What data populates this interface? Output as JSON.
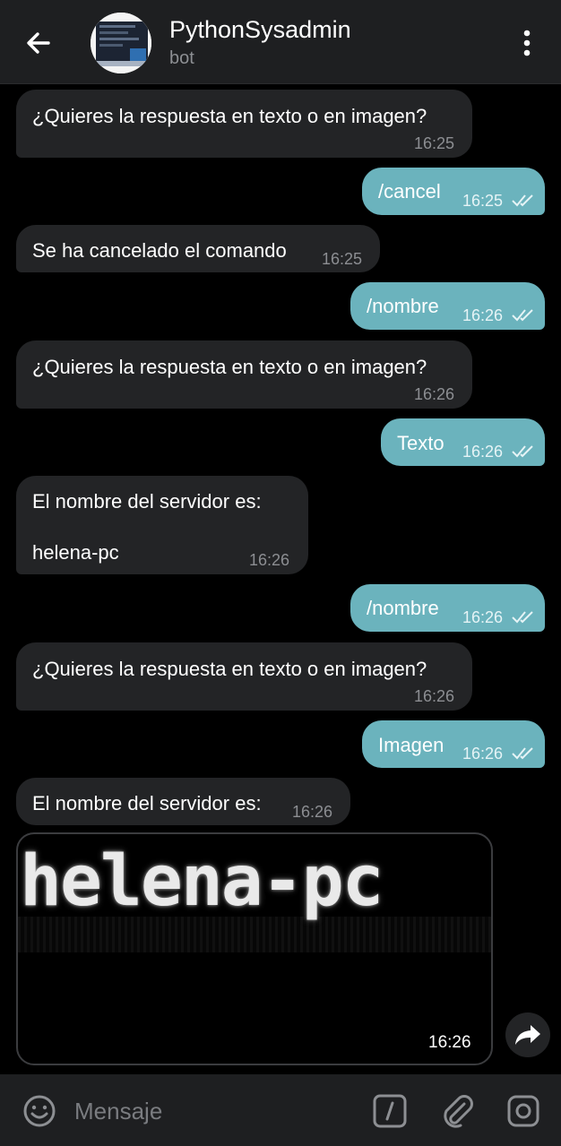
{
  "header": {
    "title": "PythonSysadmin",
    "subtitle": "bot",
    "icons": [
      "back-arrow-icon",
      "avatar",
      "more-vert-icon"
    ]
  },
  "messages": [
    {
      "dir": "in",
      "text": "¿Quieres la respuesta en texto o en imagen?",
      "time": "16:25"
    },
    {
      "dir": "out",
      "text": "/cancel",
      "time": "16:25",
      "status": "read"
    },
    {
      "dir": "in",
      "text": "Se ha cancelado el comando",
      "time": "16:25"
    },
    {
      "dir": "out",
      "text": "/nombre",
      "time": "16:26",
      "status": "read"
    },
    {
      "dir": "in",
      "text": "¿Quieres la respuesta en texto o en imagen?",
      "time": "16:26"
    },
    {
      "dir": "out",
      "text": "Texto",
      "time": "16:26",
      "status": "read"
    },
    {
      "dir": "in",
      "text_line1": "El nombre del servidor es:",
      "text_line2": "helena-pc",
      "time": "16:26"
    },
    {
      "dir": "out",
      "text": "/nombre",
      "time": "16:26",
      "status": "read"
    },
    {
      "dir": "in",
      "text": "¿Quieres la respuesta en texto o en imagen?",
      "time": "16:26"
    },
    {
      "dir": "out",
      "text": "Imagen",
      "time": "16:26",
      "status": "read"
    },
    {
      "dir": "in",
      "text": "El nombre del servidor es:",
      "time": "16:26"
    }
  ],
  "image_message": {
    "image_text": "helena-pc",
    "time": "16:26"
  },
  "input": {
    "placeholder": "Mensaje"
  },
  "colors": {
    "header_bg": "#1e1f21",
    "incoming_bubble": "#232426",
    "outgoing_bubble": "#6bb3bd",
    "background": "#000000"
  }
}
